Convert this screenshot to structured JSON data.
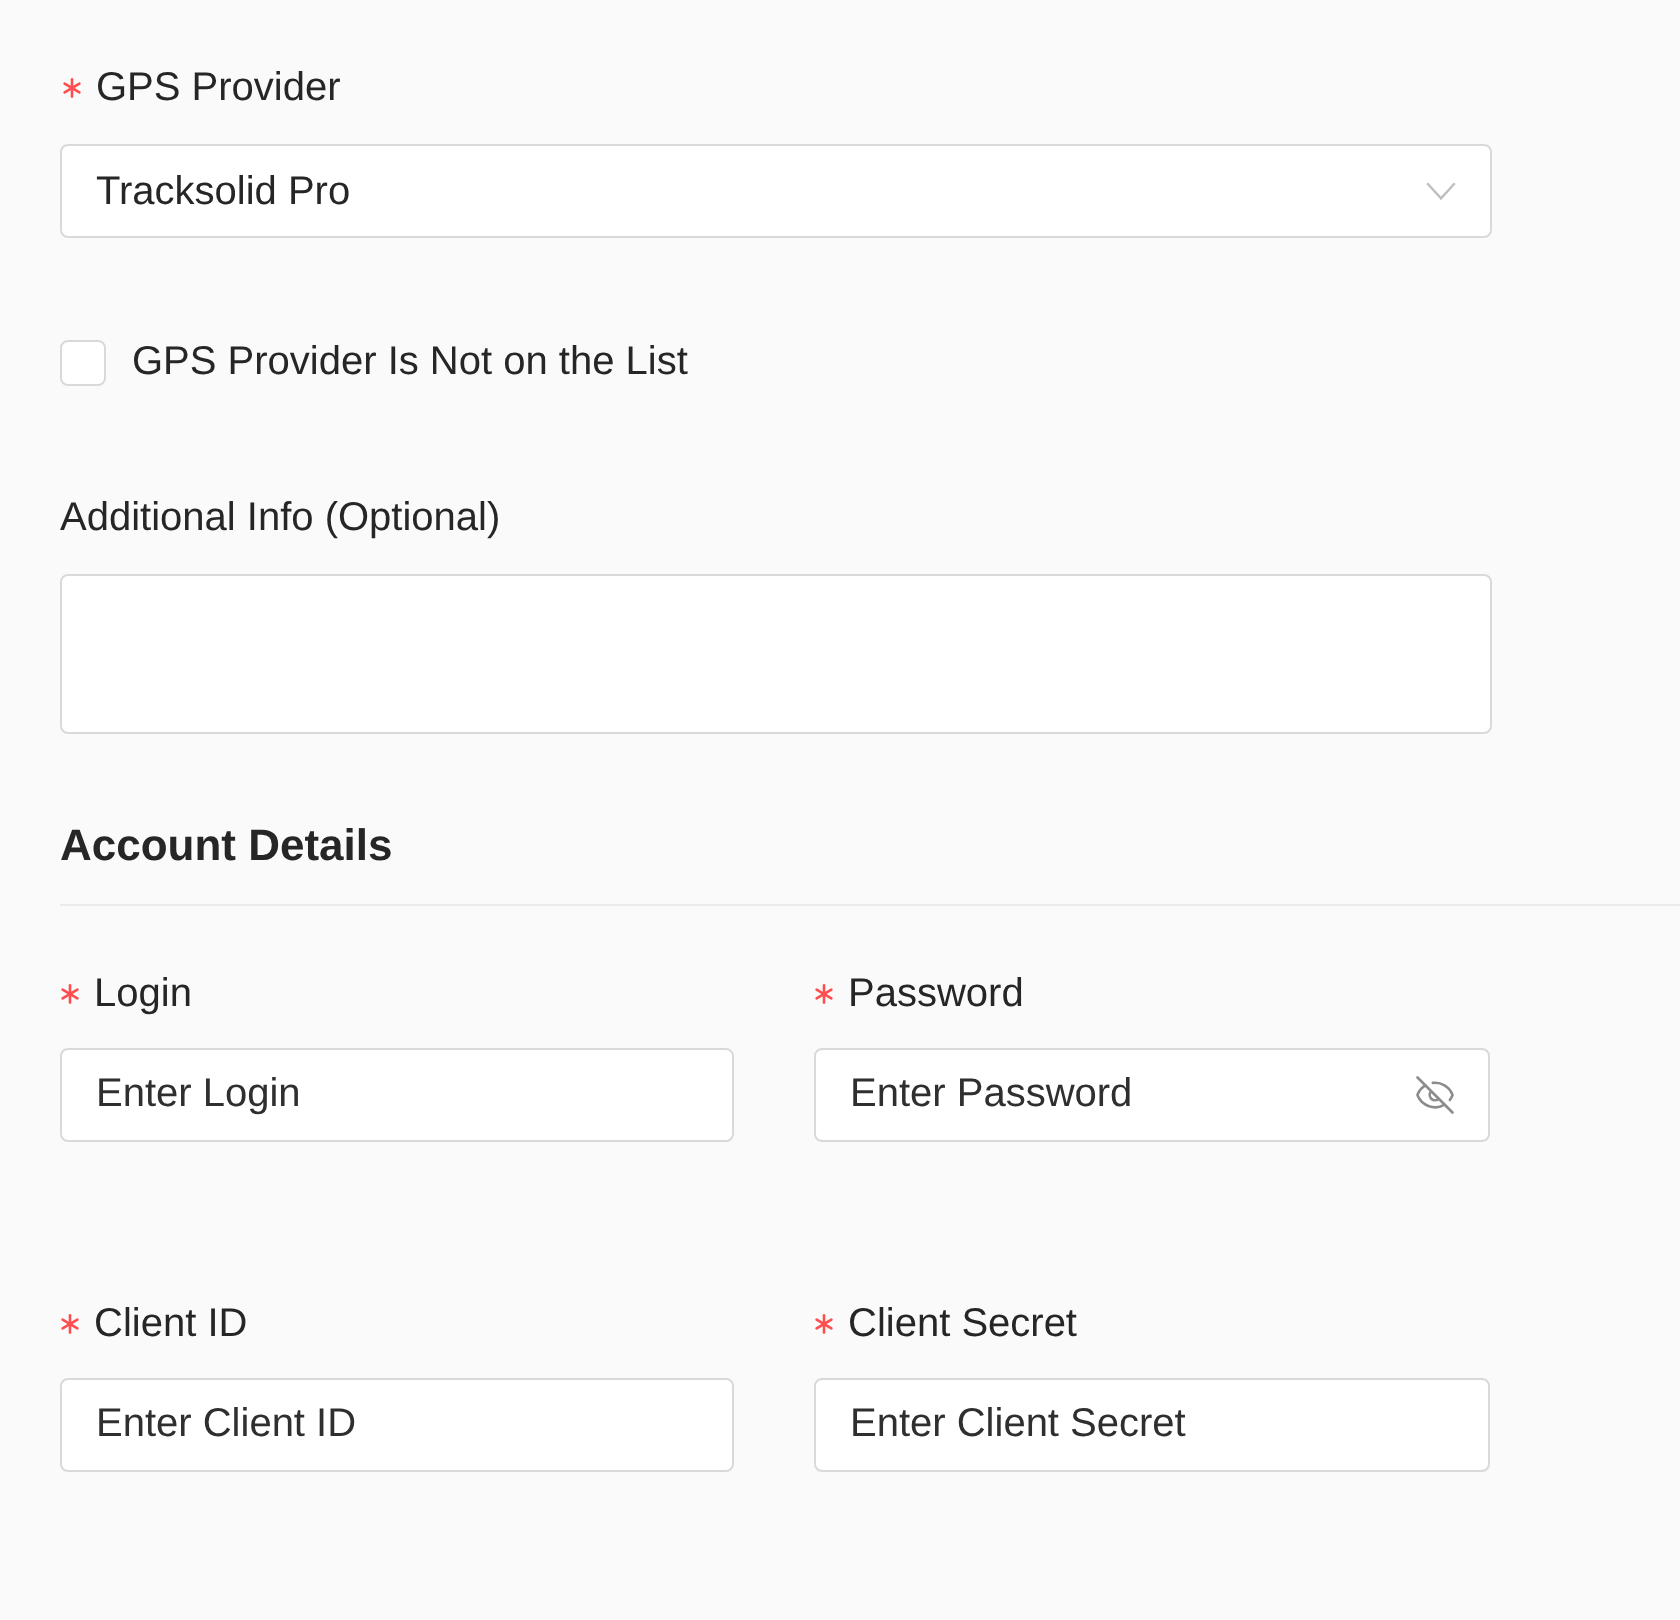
{
  "provider": {
    "label": "GPS Provider",
    "required": true,
    "value": "Tracksolid Pro"
  },
  "not_on_list": {
    "label": "GPS Provider Is Not on the List",
    "checked": false
  },
  "additional_info": {
    "label": "Additional Info (Optional)"
  },
  "account_details": {
    "title": "Account Details",
    "fields": [
      {
        "label": "Login",
        "required": true,
        "placeholder": "Enter Login",
        "kind": "text"
      },
      {
        "label": "Password",
        "required": true,
        "placeholder": "Enter Password",
        "kind": "password"
      },
      {
        "label": "Client ID",
        "required": true,
        "placeholder": "Enter Client ID",
        "kind": "text"
      },
      {
        "label": "Client Secret",
        "required": true,
        "placeholder": "Enter Client Secret",
        "kind": "text"
      }
    ]
  }
}
